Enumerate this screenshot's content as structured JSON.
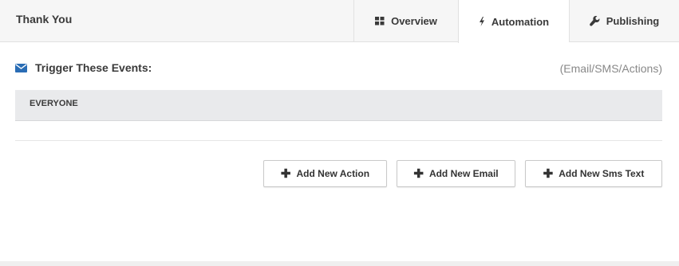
{
  "header": {
    "title": "Thank You",
    "tabs": [
      {
        "label": "Overview",
        "icon": "grid-icon",
        "active": false
      },
      {
        "label": "Automation",
        "icon": "bolt-icon",
        "active": true
      },
      {
        "label": "Publishing",
        "icon": "wrench-icon",
        "active": false
      }
    ]
  },
  "section": {
    "title": "Trigger These Events:",
    "icon": "envelope-icon",
    "hint": "(Email/SMS/Actions)",
    "group_label": "EVERYONE"
  },
  "buttons": {
    "add_action": "Add New Action",
    "add_email": "Add New Email",
    "add_sms": "Add New Sms Text"
  },
  "colors": {
    "accent": "#2a6db5",
    "header_bg": "#f6f6f6",
    "group_bg": "#e9eaec"
  }
}
